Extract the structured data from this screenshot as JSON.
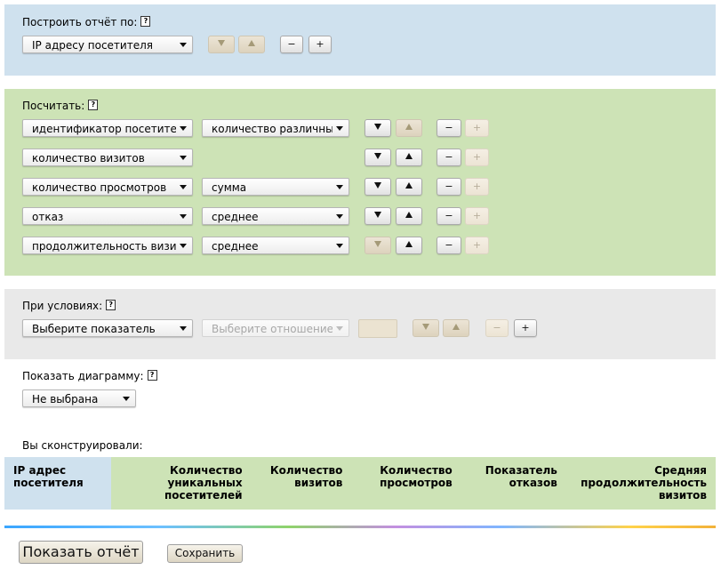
{
  "build_report": {
    "label": "Построить отчёт по:",
    "help": "?",
    "select_value": "IP адресу посетителя",
    "minus": "−",
    "plus": "+"
  },
  "count": {
    "label": "Посчитать:",
    "help": "?",
    "rows": [
      {
        "metric": "идентификатор посетителя",
        "aggregate": "количество различных"
      },
      {
        "metric": "количество визитов",
        "aggregate": ""
      },
      {
        "metric": "количество просмотров",
        "aggregate": "сумма"
      },
      {
        "metric": "отказ",
        "aggregate": "среднее"
      },
      {
        "metric": "продолжительность визита",
        "aggregate": "среднее"
      }
    ],
    "minus": "−",
    "plus": "+"
  },
  "conditions": {
    "label": "При условиях:",
    "help": "?",
    "metric_value": "Выберите показатель",
    "relation_value": "Выберите отношение",
    "minus": "−",
    "plus": "+"
  },
  "chart": {
    "label": "Показать диаграмму:",
    "help": "?",
    "select_value": "Не выбрана"
  },
  "constructed": {
    "label": "Вы сконструировали:",
    "columns": [
      "IP адрес посетителя",
      "Количество уникальных посетителей",
      "Количество визитов",
      "Количество просмотров",
      "Показатель отказов",
      "Средняя продолжительность визитов"
    ]
  },
  "actions": {
    "show_report": "Показать отчёт",
    "save": "Сохранить"
  },
  "icons": {
    "up": "triangle-up-icon",
    "down": "triangle-down-icon",
    "select_caret": "chevron-down-icon"
  },
  "colors": {
    "panel_blue": "#cfe1ee",
    "panel_green": "#cde3b6",
    "panel_gray": "#e9e9e9"
  }
}
